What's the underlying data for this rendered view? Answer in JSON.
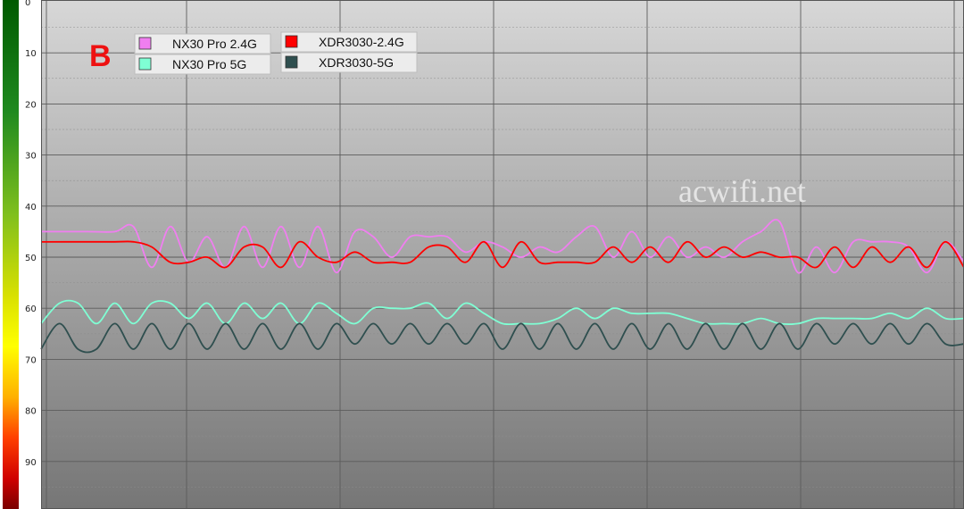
{
  "chart_data": {
    "type": "line",
    "corner_label": "B",
    "watermark": "acwifi.net",
    "y_axis": {
      "ticks": [
        0,
        10,
        20,
        30,
        40,
        50,
        60,
        70,
        80,
        90
      ],
      "range": [
        0,
        99
      ],
      "inverted": true,
      "color_scale": [
        "#006400",
        "#2e8b1e",
        "#7fbf1e",
        "#c8d400",
        "#ffff00",
        "#ffa500",
        "#ff4500",
        "#e00000",
        "#8b0000"
      ]
    },
    "grid": true,
    "legend_position": "top-left",
    "series": [
      {
        "name": "NX30 Pro 2.4G",
        "color": "#f07ef0",
        "x": [
          0,
          5,
          8,
          10,
          12,
          14,
          16,
          18,
          20,
          22,
          24,
          26,
          28,
          30,
          32,
          34,
          36,
          38,
          40,
          42,
          44,
          46,
          48,
          50,
          52,
          54,
          56,
          58,
          60,
          62,
          64,
          66,
          68,
          70,
          72,
          74,
          76,
          78,
          80,
          82,
          84,
          86,
          88,
          90,
          92,
          94,
          96,
          98,
          100
        ],
        "values": [
          45,
          45,
          45,
          44,
          52,
          44,
          51,
          46,
          52,
          44,
          52,
          44,
          52,
          44,
          53,
          45,
          46,
          50,
          46,
          46,
          46,
          49,
          47,
          48,
          50,
          48,
          49,
          46,
          44,
          50,
          45,
          50,
          46,
          50,
          48,
          50,
          47,
          45,
          43,
          53,
          48,
          53,
          47,
          47,
          47,
          48,
          53,
          47,
          51
        ]
      },
      {
        "name": "NX30 Pro 5G",
        "color": "#7fffd4",
        "x": [
          0,
          2,
          4,
          6,
          8,
          10,
          12,
          14,
          16,
          18,
          20,
          22,
          24,
          26,
          28,
          30,
          32,
          34,
          36,
          38,
          40,
          42,
          44,
          46,
          48,
          50,
          52,
          54,
          56,
          58,
          60,
          62,
          64,
          66,
          68,
          70,
          72,
          74,
          76,
          78,
          80,
          82,
          84,
          86,
          88,
          90,
          92,
          94,
          96,
          98,
          100
        ],
        "values": [
          63,
          59,
          59,
          63,
          59,
          63,
          59,
          59,
          62,
          59,
          63,
          59,
          62,
          59,
          63,
          59,
          61,
          63,
          60,
          60,
          60,
          59,
          62,
          59,
          61,
          63,
          63,
          63,
          62,
          60,
          62,
          60,
          61,
          61,
          61,
          62,
          63,
          63,
          63,
          62,
          63,
          63,
          62,
          62,
          62,
          62,
          61,
          62,
          60,
          62,
          62
        ]
      },
      {
        "name": "XDR3030-2.4G",
        "color": "#ff0000",
        "x": [
          0,
          4,
          8,
          10,
          12,
          14,
          16,
          18,
          20,
          22,
          24,
          26,
          28,
          30,
          32,
          34,
          36,
          38,
          40,
          42,
          44,
          46,
          48,
          50,
          52,
          54,
          56,
          58,
          60,
          62,
          64,
          66,
          68,
          70,
          72,
          74,
          76,
          78,
          80,
          82,
          84,
          86,
          88,
          90,
          92,
          94,
          96,
          98,
          100
        ],
        "values": [
          47,
          47,
          47,
          47,
          48,
          51,
          51,
          50,
          52,
          48,
          48,
          52,
          47,
          50,
          51,
          49,
          51,
          51,
          51,
          48,
          48,
          51,
          47,
          52,
          47,
          51,
          51,
          51,
          51,
          48,
          51,
          48,
          51,
          47,
          50,
          48,
          50,
          49,
          50,
          50,
          52,
          48,
          52,
          48,
          51,
          48,
          52,
          47,
          52
        ]
      },
      {
        "name": "XDR3030-5G",
        "color": "#2f4f4f",
        "x": [
          0,
          2,
          4,
          6,
          8,
          10,
          12,
          14,
          16,
          18,
          20,
          22,
          24,
          26,
          28,
          30,
          32,
          34,
          36,
          38,
          40,
          42,
          44,
          46,
          48,
          50,
          52,
          54,
          56,
          58,
          60,
          62,
          64,
          66,
          68,
          70,
          72,
          74,
          76,
          78,
          80,
          82,
          84,
          86,
          88,
          90,
          92,
          94,
          96,
          98,
          100
        ],
        "values": [
          68,
          63,
          68,
          68,
          63,
          68,
          63,
          68,
          63,
          68,
          63,
          68,
          63,
          68,
          63,
          68,
          63,
          67,
          63,
          67,
          63,
          67,
          63,
          67,
          63,
          68,
          63,
          68,
          63,
          68,
          63,
          68,
          63,
          68,
          63,
          68,
          63,
          68,
          63,
          68,
          63,
          68,
          63,
          67,
          63,
          67,
          63,
          67,
          63,
          67,
          67
        ]
      }
    ]
  }
}
